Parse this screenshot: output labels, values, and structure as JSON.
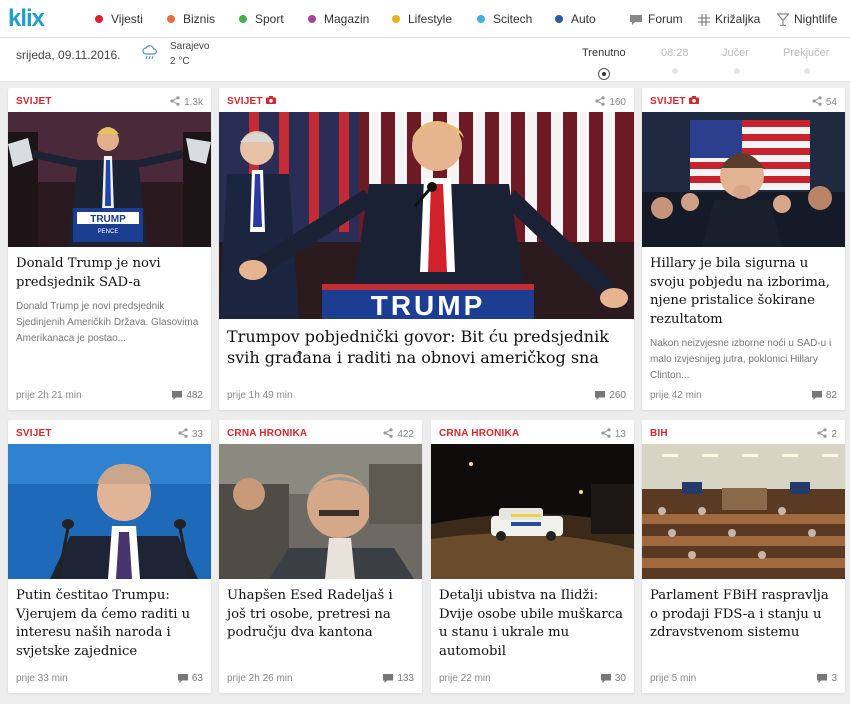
{
  "logo": {
    "text": "klix"
  },
  "nav": {
    "categories": [
      {
        "label": "Vijesti",
        "color": "#d6262d"
      },
      {
        "label": "Biznis",
        "color": "#f06a3a"
      },
      {
        "label": "Sport",
        "color": "#45b04a"
      },
      {
        "label": "Magazin",
        "color": "#a6449b"
      },
      {
        "label": "Lifestyle",
        "color": "#e5b21c"
      },
      {
        "label": "Scitech",
        "color": "#3fb1e2"
      },
      {
        "label": "Auto",
        "color": "#2c5ca8"
      }
    ],
    "forum": "Forum",
    "krizaljka": "Križaljka",
    "nightlife": "Nightlife"
  },
  "infobar": {
    "date": "srijeda, 09.11.2016.",
    "city": "Sarajevo",
    "temp": "2 °C",
    "timeline": [
      "Trenutno",
      "08:28",
      "Jučer",
      "Prekjučer"
    ]
  },
  "articles": [
    {
      "section": "SVIJET",
      "shares": "1.3k",
      "title": "Donald Trump je novi predsjednik SAD-a",
      "excerpt": "Donald Trump je novi predsjednik Sjedinjenih Američkih Država. Glasovima Amerikanaca je postao...",
      "time": "prije 2h 21 min",
      "comments": "482"
    },
    {
      "section": "SVIJET",
      "camera": true,
      "shares": "160",
      "title": "Trumpov pobjednički govor: Bit ću predsjednik svih građana i raditi na obnovi američkog sna",
      "time": "prije 1h 49 min",
      "comments": "260",
      "image_caption": "TRUMP"
    },
    {
      "section": "SVIJET",
      "camera": true,
      "shares": "54",
      "title": "Hillary je bila sigurna u svoju pobjedu na izborima, njene pristalice šokirane rezultatom",
      "excerpt": "Nakon neizvjesne izborne noći u SAD-u i malo izvjesnijeg jutra, poklonici Hillary Clinton...",
      "time": "prije 42 min",
      "comments": "82"
    },
    {
      "section": "SVIJET",
      "shares": "33",
      "title": "Putin čestitao Trumpu: Vjerujem da ćemo raditi u interesu naših naroda i svjetske zajednice",
      "time": "prije 33 min",
      "comments": "63"
    },
    {
      "section": "CRNA HRONIKA",
      "shares": "422",
      "title": "Uhapšen Esed Radeljaš i još tri osobe, pretresi na području dva kantona",
      "time": "prije 2h 26 min",
      "comments": "133"
    },
    {
      "section": "CRNA HRONIKA",
      "shares": "13",
      "title": "Detalji ubistva na Ilidži: Dvije osobe ubile muškarca u stanu i ukrale mu automobil",
      "time": "prije 22 min",
      "comments": "30"
    },
    {
      "section": "BIH",
      "shares": "2",
      "title": "Parlament FBiH raspravlja o prodaji FDS-a i stanju u zdravstvenom sistemu",
      "time": "prije 5 min",
      "comments": "3"
    }
  ]
}
